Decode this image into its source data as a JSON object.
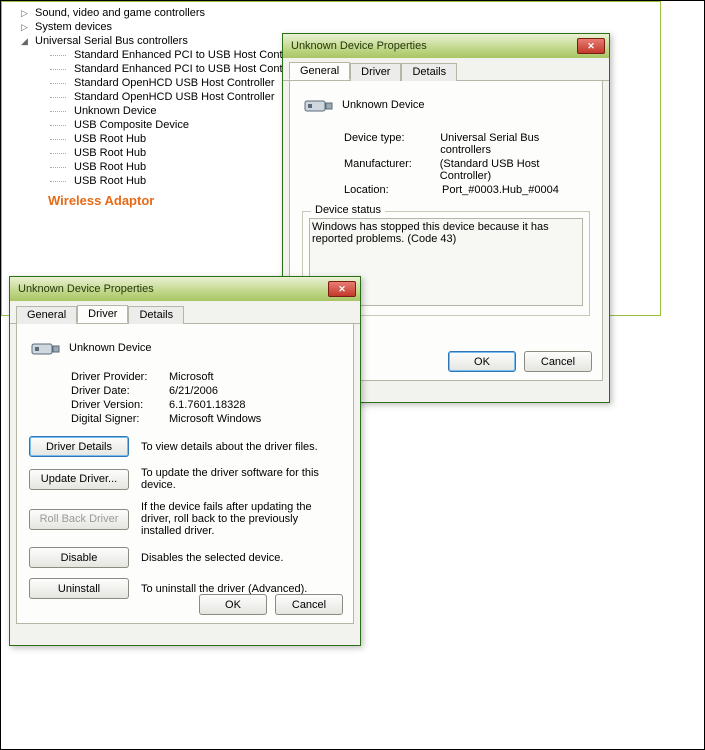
{
  "tree": {
    "n0": "Sound, video and game controllers",
    "n1": "System devices",
    "n2": "Universal Serial Bus controllers",
    "c": [
      "Standard Enhanced PCI to USB Host Controller",
      "Standard Enhanced PCI to USB Host Controller",
      "Standard OpenHCD USB Host Controller",
      "Standard OpenHCD USB Host Controller",
      "Unknown Device",
      "USB Composite Device",
      "USB Root Hub",
      "USB Root Hub",
      "USB Root Hub",
      "USB Root Hub"
    ],
    "annotation": "Wireless Adaptor"
  },
  "dlgGeneral": {
    "title": "Unknown Device Properties",
    "tabs": {
      "general": "General",
      "driver": "Driver",
      "details": "Details"
    },
    "deviceName": "Unknown Device",
    "rows": {
      "typeK": "Device type:",
      "typeV": "Universal Serial Bus controllers",
      "mfrK": "Manufacturer:",
      "mfrV": "(Standard USB Host Controller)",
      "locK": "Location:",
      "locV": "Port_#0003.Hub_#0004"
    },
    "statusLegend": "Device status",
    "statusText": "Windows has stopped this device because it has reported problems. (Code 43)",
    "ok": "OK",
    "cancel": "Cancel"
  },
  "dlgDriver": {
    "title": "Unknown Device Properties",
    "tabs": {
      "general": "General",
      "driver": "Driver",
      "details": "Details"
    },
    "deviceName": "Unknown Device",
    "rows": {
      "provK": "Driver Provider:",
      "provV": "Microsoft",
      "dateK": "Driver Date:",
      "dateV": "6/21/2006",
      "verK": "Driver Version:",
      "verV": "6.1.7601.18328",
      "sigK": "Digital Signer:",
      "sigV": "Microsoft Windows"
    },
    "actions": {
      "details": {
        "btn": "Driver Details",
        "desc": "To view details about the driver files."
      },
      "update": {
        "btn": "Update Driver...",
        "desc": "To update the driver software for this device."
      },
      "rollback": {
        "btn": "Roll Back Driver",
        "desc": "If the device fails after updating the driver, roll back to the previously installed driver."
      },
      "disable": {
        "btn": "Disable",
        "desc": "Disables the selected device."
      },
      "uninstall": {
        "btn": "Uninstall",
        "desc": "To uninstall the driver (Advanced)."
      }
    },
    "ok": "OK",
    "cancel": "Cancel"
  }
}
